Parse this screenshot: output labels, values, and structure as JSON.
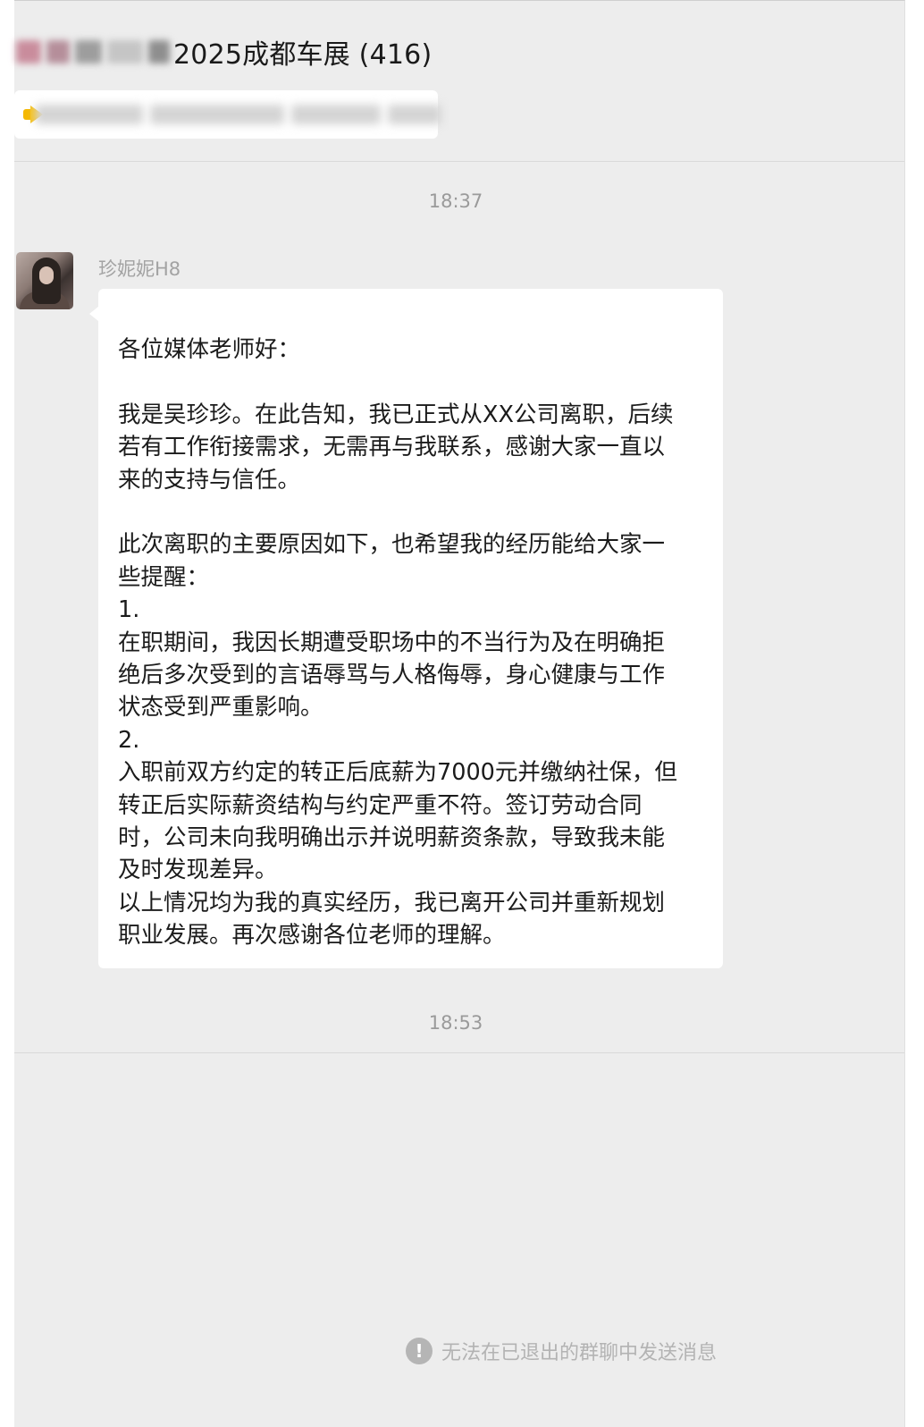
{
  "header": {
    "chat_title": "2025成都车展 (416)"
  },
  "messages": [
    {
      "timestamp": "18:37",
      "sender": "珍妮妮H8",
      "lines": [
        "各位媒体老师好：",
        "",
        "我是吴珍珍。在此告知，我已正式从XX公司离职，后续",
        "若有工作衔接需求，无需再与我联系，感谢大家一直以",
        "来的支持与信任。",
        "",
        "此次离职的主要原因如下，也希望我的经历能给大家一",
        "些提醒：",
        "1.",
        "在职期间，我因长期遭受职场中的不当行为及在明确拒",
        "绝后多次受到的言语辱骂与人格侮辱，身心健康与工作",
        "状态受到严重影响。",
        "2.",
        "入职前双方约定的转正后底薪为7000元并缴纳社保，但",
        "转正后实际薪资结构与约定严重不符。签订劳动合同",
        "时，公司未向我明确出示并说明薪资条款，导致我未能",
        "及时发现差异。",
        "以上情况均为我的真实经历，我已离开公司并重新规划",
        "职业发展。再次感谢各位老师的理解。"
      ]
    }
  ],
  "timestamp2": "18:53",
  "footer": {
    "status_icon": "exclamation-icon",
    "status_text": "无法在已退出的群聊中发送消息"
  },
  "colors": {
    "background": "#ededed",
    "bubble": "#ffffff",
    "notice_icon": "#f5b800"
  }
}
